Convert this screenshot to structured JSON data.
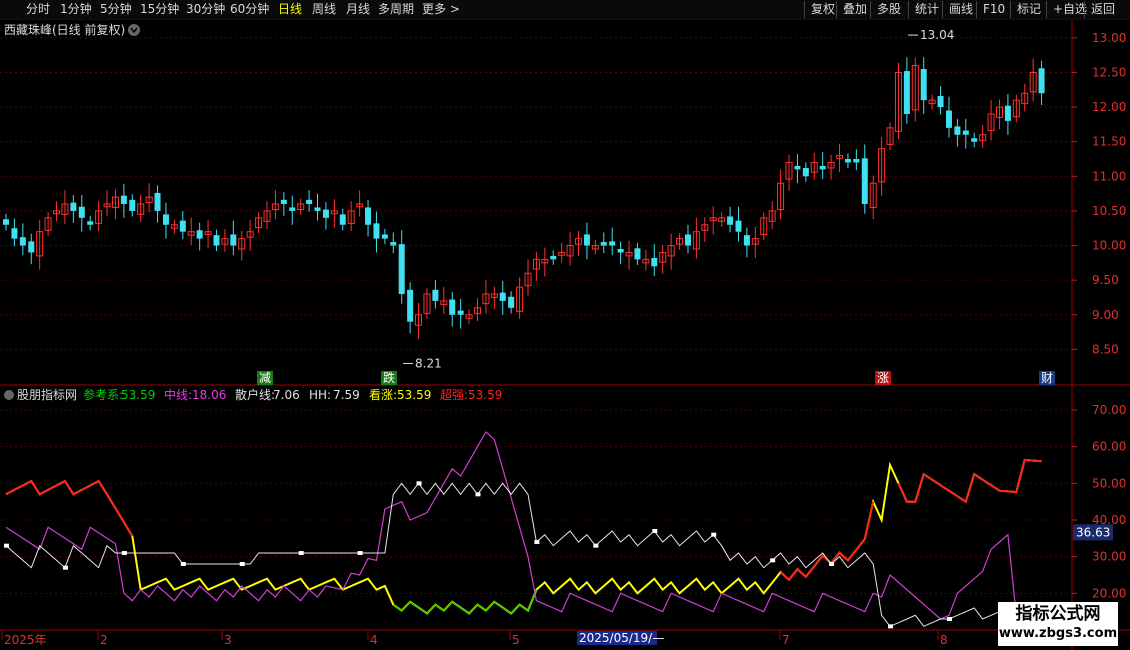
{
  "toolbar": {
    "left": [
      "分时",
      "1分钟",
      "5分钟",
      "15分钟",
      "30分钟",
      "60分钟",
      "日线",
      "周线",
      "月线",
      "多周期",
      "更多"
    ],
    "active": "日线",
    "right": [
      "复权",
      "叠加",
      "多股",
      "统计",
      "画线",
      "F10",
      "标记",
      "+自选",
      "返回"
    ]
  },
  "main": {
    "title": "西藏珠峰(日线 前复权)",
    "y_ticks": [
      "13.00",
      "12.50",
      "12.00",
      "11.50",
      "11.00",
      "10.50",
      "10.00",
      "9.50",
      "9.00",
      "8.50"
    ],
    "high_label": "13.04",
    "low_label": "8.21",
    "signals": [
      {
        "text": "减",
        "bg": "#1a7a1a",
        "color": "#ffffff"
      },
      {
        "text": "跌",
        "bg": "#1a7a1a",
        "color": "#ffffff"
      },
      {
        "text": "涨",
        "bg": "#c01010",
        "color": "#ffffff"
      },
      {
        "text": "财",
        "bg": "#1a3a8a",
        "color": "#ffffff"
      }
    ]
  },
  "indicator": {
    "name": "股朋指标网",
    "values": [
      {
        "label": "参考系:",
        "value": "53.59",
        "color": "#00d000"
      },
      {
        "label": "中线:",
        "value": "18.06",
        "color": "#e040e0"
      },
      {
        "label": "散户线:",
        "value": "7.06",
        "color": "#e0e0e0"
      },
      {
        "label": "HH:",
        "value": "7.59",
        "color": "#e0e0e0"
      },
      {
        "label": "看涨:",
        "value": "53.59",
        "color": "#ffff00"
      },
      {
        "label": "超强:",
        "value": "53.59",
        "color": "#ff2020"
      }
    ],
    "y_ticks": [
      "70.00",
      "60.00",
      "50.00",
      "40.00",
      "30.00",
      "20.00"
    ],
    "current_value": "36.63"
  },
  "x_axis": {
    "labels": [
      "2025年",
      "2",
      "3",
      "4",
      "5",
      "7",
      "8"
    ],
    "cursor_date": "2025/05/19/—"
  },
  "watermark": {
    "line1": "指标公式网",
    "line2": "www.zbgs3.com"
  },
  "chart_data": {
    "type": "candlestick",
    "title": "西藏珠峰(日线 前复权)",
    "ylim": [
      8.0,
      13.2
    ],
    "highest": 13.04,
    "lowest": 8.21,
    "closes": [
      10.3,
      10.1,
      10.0,
      9.9,
      10.2,
      10.4,
      10.5,
      10.6,
      10.5,
      10.4,
      10.3,
      10.5,
      10.6,
      10.7,
      10.6,
      10.5,
      10.6,
      10.7,
      10.5,
      10.3,
      10.3,
      10.2,
      10.2,
      10.1,
      10.2,
      10.0,
      10.1,
      10.0,
      10.1,
      10.2,
      10.4,
      10.5,
      10.6,
      10.6,
      10.5,
      10.6,
      10.6,
      10.5,
      10.4,
      10.5,
      10.3,
      10.5,
      10.6,
      10.3,
      10.1,
      10.1,
      10.0,
      9.3,
      8.9,
      9.0,
      9.3,
      9.2,
      9.2,
      9.0,
      9.0,
      9.0,
      9.1,
      9.3,
      9.3,
      9.2,
      9.1,
      9.4,
      9.6,
      9.8,
      9.8,
      9.8,
      9.9,
      10.0,
      10.1,
      10.0,
      10.0,
      10.0,
      10.0,
      9.9,
      9.9,
      9.8,
      9.8,
      9.7,
      9.9,
      10.0,
      10.1,
      10.0,
      10.2,
      10.3,
      10.4,
      10.4,
      10.3,
      10.2,
      10.0,
      10.1,
      10.4,
      10.5,
      10.9,
      11.2,
      11.1,
      11.0,
      11.2,
      11.1,
      11.2,
      11.3,
      11.2,
      11.2,
      10.6,
      10.9,
      11.4,
      11.7,
      12.5,
      11.9,
      12.6,
      12.1,
      12.1,
      12.0,
      11.7,
      11.6,
      11.6,
      11.5,
      11.6,
      11.9,
      12.0,
      11.8,
      12.1,
      12.2,
      12.5,
      12.2
    ]
  }
}
